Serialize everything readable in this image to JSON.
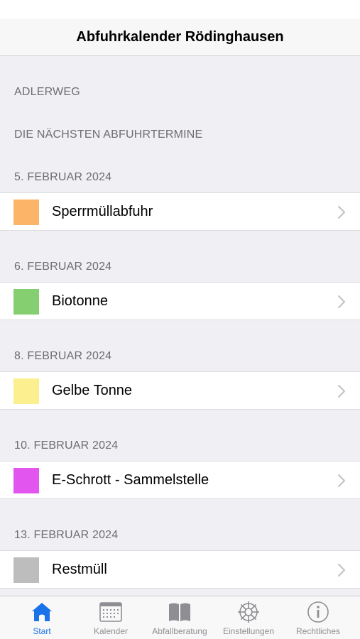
{
  "header": {
    "title": "Abfuhrkalender Rödinghausen"
  },
  "street": "ADLERWEG",
  "section_title": "DIE NÄCHSTEN ABFUHRTERMINE",
  "entries": [
    {
      "date": "5. FEBRUAR 2024",
      "label": "Sperrmüllabfuhr",
      "color": "#fcb469"
    },
    {
      "date": "6. FEBRUAR 2024",
      "label": "Biotonne",
      "color": "#85cf71"
    },
    {
      "date": "8. FEBRUAR 2024",
      "label": "Gelbe Tonne",
      "color": "#fcef8f"
    },
    {
      "date": "10. FEBRUAR 2024",
      "label": "E-Schrott - Sammelstelle",
      "color": "#e256ef"
    },
    {
      "date": "13. FEBRUAR 2024",
      "label": "Restmüll",
      "color": "#bdbdbd"
    }
  ],
  "tabs": [
    {
      "label": "Start",
      "icon": "home-icon",
      "active": true
    },
    {
      "label": "Kalender",
      "icon": "calendar-icon",
      "active": false
    },
    {
      "label": "Abfallberatung",
      "icon": "book-icon",
      "active": false
    },
    {
      "label": "Einstellungen",
      "icon": "gear-icon",
      "active": false
    },
    {
      "label": "Rechtliches",
      "icon": "info-icon",
      "active": false
    }
  ],
  "colors": {
    "accent": "#1a73e8",
    "inactive": "#8e8e93"
  }
}
